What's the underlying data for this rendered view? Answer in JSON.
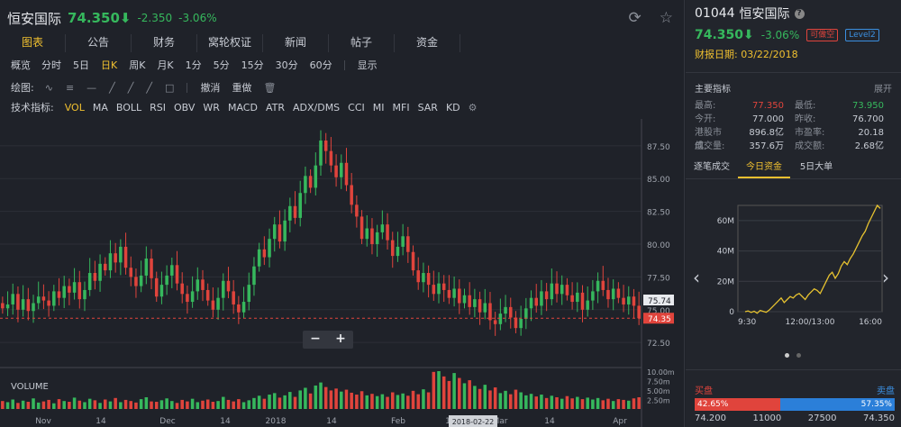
{
  "header": {
    "name": "恒安国际",
    "price": "74.350⬇",
    "change": "-2.350",
    "pct": "-3.06%",
    "refresh_icon": "refresh-icon",
    "star_icon": "star-icon"
  },
  "tabs": [
    "图表",
    "公告",
    "财务",
    "窝轮权证",
    "新闻",
    "帖子",
    "资金"
  ],
  "period": {
    "label": "概览",
    "items": [
      "分时",
      "5日",
      "日K",
      "周K",
      "月K",
      "1分",
      "5分",
      "15分",
      "30分",
      "60分"
    ],
    "active": "日K",
    "display": "显示"
  },
  "draw": {
    "label": "绘图:",
    "undo": "撤消",
    "redo": "重做"
  },
  "indicators": {
    "label": "技术指标:",
    "items": [
      "VOL",
      "MA",
      "BOLL",
      "RSI",
      "OBV",
      "WR",
      "MACD",
      "ATR",
      "ADX/DMS",
      "CCI",
      "MI",
      "MFI",
      "SAR",
      "KD"
    ],
    "active": "VOL"
  },
  "zoom": {
    "minus": "−",
    "plus": "+"
  },
  "chart_data": {
    "type": "candlestick",
    "price_ticks": [
      "87.50",
      "85.00",
      "82.50",
      "80.00",
      "77.50",
      "75.00",
      "72.50"
    ],
    "volume_ticks": [
      "10.00m",
      "7.50m",
      "5.00m",
      "2.50m"
    ],
    "x_labels": [
      "Nov",
      "14",
      "Dec",
      "14",
      "2018",
      "14",
      "Feb",
      "14",
      "Mar",
      "14",
      "Apr"
    ],
    "cursor_date": "2018-02-22",
    "last_price_label": "74.35",
    "hover_price_label": "75.74",
    "volume_title": "VOLUME",
    "ylim": [
      71,
      89
    ],
    "closes": [
      75.1,
      75.4,
      76.2,
      75.0,
      75.8,
      74.9,
      75.5,
      76.0,
      75.7,
      75.3,
      76.4,
      75.9,
      76.8,
      76.3,
      77.1,
      75.8,
      76.5,
      77.8,
      77.2,
      78.5,
      78.0,
      79.3,
      78.6,
      79.8,
      78.2,
      77.5,
      76.8,
      77.6,
      78.9,
      77.4,
      76.0,
      76.9,
      77.6,
      78.4,
      77.0,
      76.2,
      75.6,
      76.4,
      77.3,
      76.5,
      75.7,
      75.0,
      75.9,
      77.2,
      76.4,
      75.4,
      74.8,
      75.6,
      76.9,
      78.3,
      79.6,
      79.0,
      80.4,
      81.5,
      80.2,
      81.8,
      82.9,
      82.0,
      83.9,
      85.2,
      84.3,
      86.0,
      87.9,
      87.1,
      86.0,
      85.1,
      86.2,
      84.5,
      83.0,
      82.1,
      80.4,
      81.2,
      80.0,
      80.9,
      81.5,
      80.3,
      79.1,
      79.8,
      80.6,
      79.4,
      78.0,
      77.1,
      77.8,
      76.9,
      76.2,
      77.0,
      76.5,
      75.9,
      76.6,
      75.5,
      76.1,
      75.2,
      75.8,
      74.8,
      75.5,
      74.2,
      73.9,
      74.7,
      75.2,
      74.4,
      73.6,
      74.3,
      75.1,
      75.9,
      75.3,
      76.4,
      75.8,
      77.0,
      76.2,
      76.9,
      76.1,
      75.6,
      76.3,
      75.0,
      75.7,
      76.4,
      77.2,
      76.5,
      75.8,
      76.6,
      75.9,
      75.4,
      76.0,
      75.3,
      74.35
    ],
    "volumes": [
      2.1,
      1.8,
      2.5,
      1.6,
      2.2,
      1.9,
      2.8,
      1.7,
      2.0,
      2.4,
      1.5,
      2.6,
      2.1,
      1.9,
      3.0,
      2.2,
      1.8,
      2.7,
      2.3,
      1.6,
      2.5,
      2.0,
      2.9,
      1.8,
      2.4,
      2.1,
      1.7,
      2.6,
      3.1,
      2.0,
      1.9,
      2.3,
      2.8,
      2.1,
      1.6,
      2.4,
      2.0,
      2.7,
      1.8,
      2.2,
      2.5,
      1.9,
      2.1,
      3.2,
      2.4,
      2.0,
      2.6,
      1.8,
      2.3,
      2.9,
      3.5,
      2.7,
      3.8,
      4.2,
      3.0,
      3.6,
      4.5,
      3.2,
      4.9,
      5.6,
      4.1,
      6.2,
      7.0,
      5.8,
      4.9,
      5.4,
      4.6,
      5.1,
      4.3,
      3.8,
      4.7,
      3.6,
      4.0,
      3.4,
      3.9,
      3.2,
      4.4,
      3.7,
      4.1,
      3.5,
      4.8,
      3.9,
      5.2,
      4.4,
      9.8,
      10.0,
      8.6,
      7.4,
      9.5,
      8.2,
      6.8,
      7.6,
      6.1,
      5.3,
      6.4,
      4.9,
      5.7,
      4.2,
      4.8,
      3.9,
      5.1,
      4.4,
      3.6,
      4.0,
      3.3,
      3.8,
      2.9,
      3.5,
      3.1,
      2.7,
      3.4,
      2.8,
      3.2,
      2.6,
      3.0,
      2.5,
      2.9,
      2.3,
      2.7,
      2.1,
      2.6,
      2.4,
      2.2,
      2.8,
      3.1
    ]
  },
  "side": {
    "code": "01044",
    "name": "恒安国际",
    "q": "?",
    "price": "74.350⬇",
    "pct": "-3.06%",
    "badge1": "可做空",
    "badge2": "Level2",
    "report_date": "财报日期: 03/22/2018",
    "section": "主要指标",
    "expand": "展开",
    "stats": [
      {
        "k1": "最高:",
        "v1": "77.350",
        "k2": "最低:",
        "v2": "73.950"
      },
      {
        "k1": "今开:",
        "v1": "77.000",
        "k2": "昨收:",
        "v2": "76.700"
      },
      {
        "k1": "港股市值:",
        "v1": "896.8亿",
        "k2": "市盈率:",
        "v2": "20.18"
      },
      {
        "k1": "成交量:",
        "v1": "357.6万",
        "k2": "成交额:",
        "v2": "2.68亿"
      }
    ],
    "tabs": [
      "逐笔成交",
      "今日资金",
      "5日大单"
    ],
    "active_tab": "今日资金",
    "flow": {
      "y_ticks": [
        "60M",
        "40M",
        "20M",
        "0"
      ],
      "x_ticks": [
        "9:30",
        "12:00/13:00",
        "16:00"
      ],
      "values": [
        0,
        0.5,
        -0.5,
        0.3,
        -1,
        0.8,
        0.2,
        -0.4,
        1.0,
        3,
        5,
        7,
        9,
        6,
        8,
        10,
        9,
        11,
        12,
        10,
        8,
        11,
        13,
        15,
        14,
        12,
        16,
        20,
        24,
        26,
        22,
        25,
        30,
        33,
        31,
        35,
        38,
        42,
        46,
        50,
        53,
        58,
        62,
        66,
        70,
        68
      ]
    },
    "buy": "买盘",
    "sell": "卖盘",
    "buy_pct": "42.65%",
    "sell_pct": "57.35%",
    "buy_price": "74.200",
    "buy_qty": "11000",
    "sell_qty": "27500",
    "sell_price": "74.350"
  }
}
